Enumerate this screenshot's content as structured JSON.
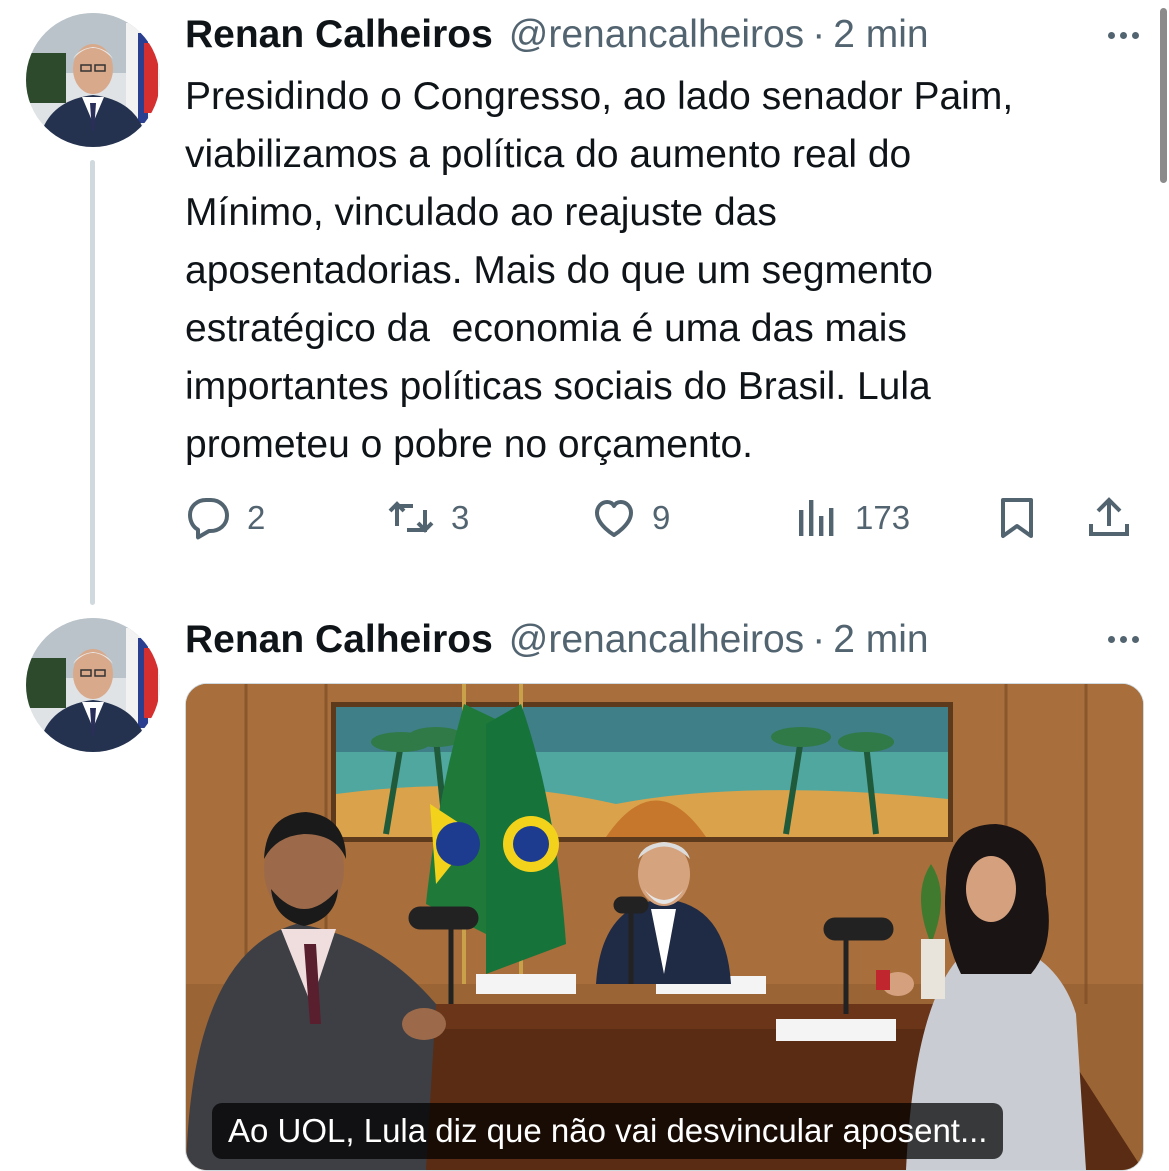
{
  "tweets": [
    {
      "author_name": "Renan Calheiros",
      "handle": "@renancalheiros",
      "separator": "·",
      "time": "2 min",
      "text": "Presidindo o Congresso, ao lado senador Paim,\nviabilizamos a política do aumento real do\nMínimo, vinculado ao reajuste das\naposentadorias. Mais do que um segmento\nestratégico da  economia é uma das mais\nimportantes políticas sociais do Brasil. Lula\nprometeu o pobre no orçamento.",
      "actions": {
        "replies": "2",
        "retweets": "3",
        "likes": "9",
        "views": "173"
      }
    },
    {
      "author_name": "Renan Calheiros",
      "handle": "@renancalheiros",
      "separator": "·",
      "time": "2 min",
      "media_caption": "Ao UOL, Lula diz que não vai desvincular aposent..."
    }
  ],
  "colors": {
    "text_primary": "#0f1419",
    "text_secondary": "#536471",
    "thread_line": "#cfd9de"
  },
  "icons": [
    "more-dots-icon",
    "reply-icon",
    "retweet-icon",
    "like-icon",
    "views-icon",
    "bookmark-icon",
    "share-icon"
  ]
}
